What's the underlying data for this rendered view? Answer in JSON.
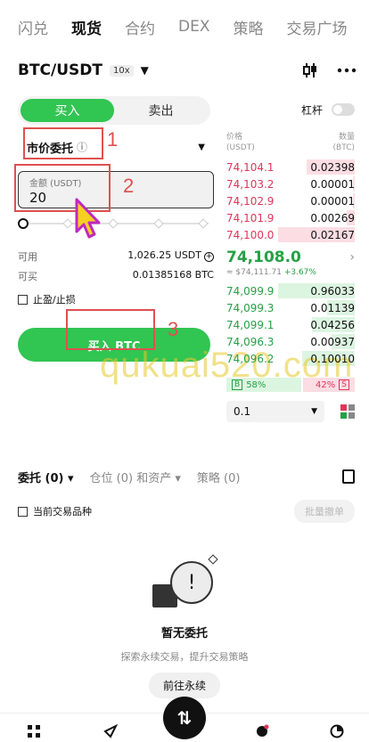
{
  "top_tabs": [
    {
      "label": "闪兑",
      "active": false
    },
    {
      "label": "现货",
      "active": true
    },
    {
      "label": "合约",
      "active": false
    },
    {
      "label": "DEX",
      "active": false
    },
    {
      "label": "策略",
      "active": false
    },
    {
      "label": "交易广场",
      "active": false
    }
  ],
  "pair": {
    "name": "BTC/USDT",
    "leverage_badge": "10x"
  },
  "trade_form": {
    "buy_label": "买入",
    "sell_label": "卖出",
    "order_type": "市价委托",
    "amount_label": "金额 (USDT)",
    "amount_value": "20",
    "available_label": "可用",
    "available_value": "1,026.25 USDT",
    "can_buy_label": "可买",
    "can_buy_value": "0.01385168 BTC",
    "tpsl_label": "止盈/止损",
    "submit_label": "买入 BTC"
  },
  "annotations": [
    "1",
    "2",
    "3"
  ],
  "leverage_toggle_label": "杠杆",
  "orderbook": {
    "price_header": "价格",
    "price_unit": "(USDT)",
    "qty_header": "数量",
    "qty_unit": "(BTC)",
    "asks": [
      {
        "price": "74,104.1",
        "qty": "0.02398",
        "depth": 0.62
      },
      {
        "price": "74,103.2",
        "qty": "0.00001",
        "depth": 0.02
      },
      {
        "price": "74,102.9",
        "qty": "0.00001",
        "depth": 0.02
      },
      {
        "price": "74,101.9",
        "qty": "0.00269",
        "depth": 0.1
      },
      {
        "price": "74,100.0",
        "qty": "0.02167",
        "depth": 1.0
      }
    ],
    "last_price": "74,108.0",
    "last_price_fiat": "≈ $74,111.71",
    "change": "+3.67%",
    "bids": [
      {
        "price": "74,099.9",
        "qty": "0.96033",
        "depth": 1.0
      },
      {
        "price": "74,099.3",
        "qty": "0.01139",
        "depth": 0.36
      },
      {
        "price": "74,099.1",
        "qty": "0.04256",
        "depth": 0.55
      },
      {
        "price": "74,096.3",
        "qty": "0.00937",
        "depth": 0.3
      },
      {
        "price": "74,096.2",
        "qty": "0.10010",
        "depth": 0.68
      }
    ],
    "buy_ratio_tag": "B",
    "buy_ratio": "58%",
    "sell_ratio": "42%",
    "sell_ratio_tag": "S",
    "depth_value": "0.1"
  },
  "watermark": "qukuai520.com",
  "orders": {
    "tabs": [
      {
        "label": "委托 (0)",
        "active": true
      },
      {
        "label": "仓位 (0) 和资产",
        "active": false
      },
      {
        "label": "策略 (0)",
        "active": false
      }
    ],
    "current_pair_label": "当前交易品种",
    "batch_cancel_label": "批量撤单",
    "empty_title": "暂无委托",
    "empty_sub": "探索永续交易，提升交易策略",
    "empty_button": "前往永续"
  },
  "colors": {
    "buy_green": "#31c552",
    "ask_red": "#e0355a",
    "annotation_red": "#e05050"
  }
}
